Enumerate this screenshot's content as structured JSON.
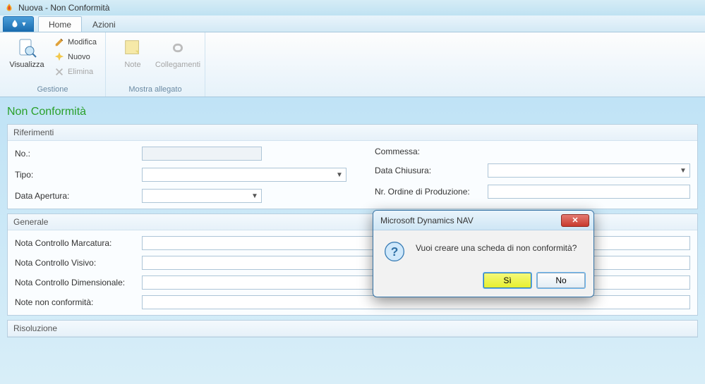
{
  "window": {
    "title": "Nuova - Non Conformità"
  },
  "tabs": {
    "home": "Home",
    "actions": "Azioni"
  },
  "ribbon": {
    "visualizza": "Visualizza",
    "modifica": "Modifica",
    "nuovo": "Nuovo",
    "elimina": "Elimina",
    "gestione": "Gestione",
    "note": "Note",
    "collegamenti": "Collegamenti",
    "mostra_allegato": "Mostra allegato"
  },
  "page": {
    "title": "Non Conformità"
  },
  "sections": {
    "riferimenti": {
      "title": "Riferimenti",
      "labels": {
        "no": "No.:",
        "tipo": "Tipo:",
        "data_apertura": "Data Apertura:",
        "commessa": "Commessa:",
        "data_chiusura": "Data Chiusura:",
        "nr_ordine": "Nr. Ordine di Produzione:"
      },
      "values": {
        "no": "",
        "tipo": "",
        "data_apertura": "",
        "commessa": "",
        "data_chiusura": "",
        "nr_ordine": ""
      }
    },
    "generale": {
      "title": "Generale",
      "labels": {
        "marcatura": "Nota Controllo Marcatura:",
        "visivo": "Nota Controllo Visivo:",
        "dimensionale": "Nota Controllo Dimensionale:",
        "non_conf": "Note non conformità:"
      },
      "values": {
        "marcatura": "",
        "visivo": "",
        "dimensionale": "",
        "non_conf": ""
      }
    },
    "risoluzione": {
      "title": "Risoluzione"
    }
  },
  "dialog": {
    "title": "Microsoft Dynamics NAV",
    "message": "Vuoi creare una scheda di non conformità?",
    "yes": "Sì",
    "no": "No"
  }
}
